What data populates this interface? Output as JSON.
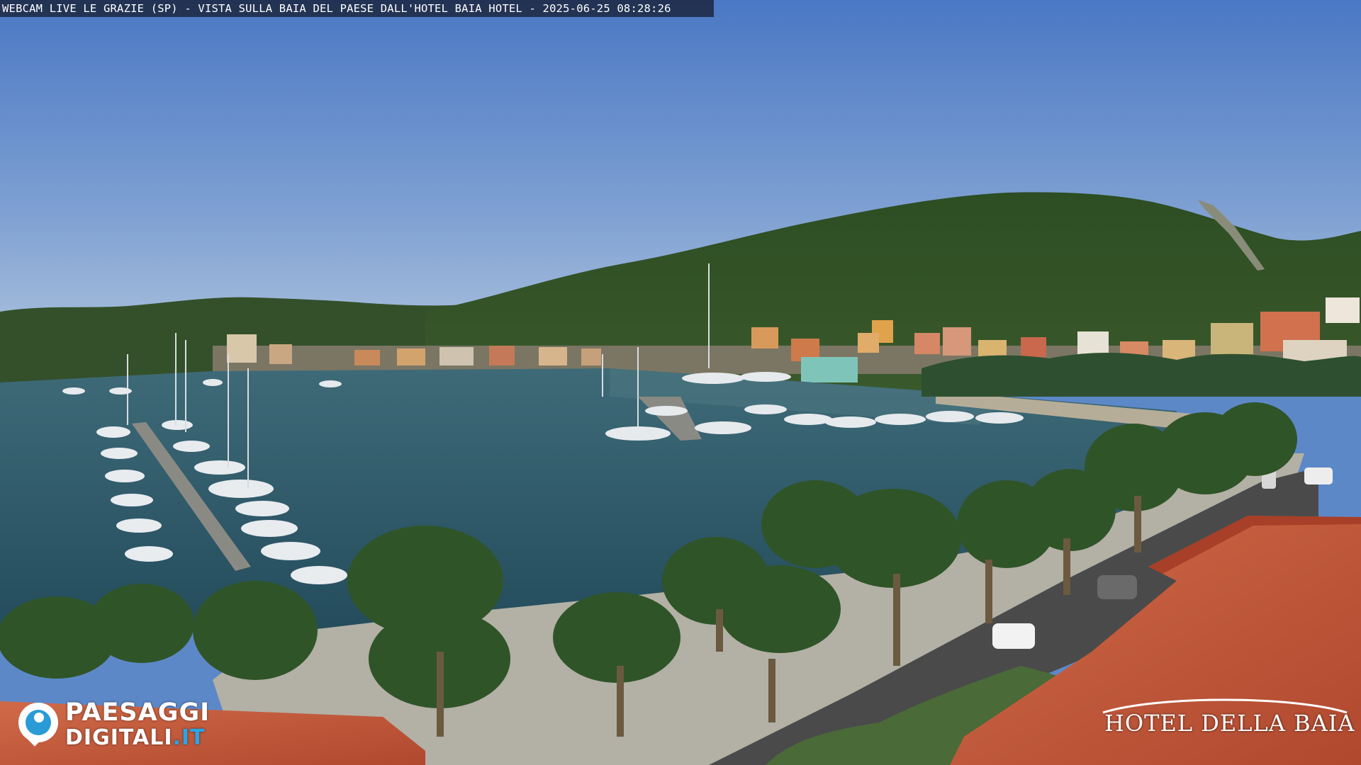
{
  "overlay": {
    "caption": "WEBCAM LIVE LE GRAZIE (SP) - VISTA SULLA BAIA DEL PAESE DALL'HOTEL BAIA HOTEL - 2025-06-25 08:28:26"
  },
  "branding": {
    "logo_icon": "paesaggi-digitali-pin-icon",
    "name_top": "PAESAGGI",
    "name_bottom": "DIGITALI",
    "name_suffix": ".IT",
    "accent_color": "#2aa5e6"
  },
  "hotel": {
    "name": "HOTEL DELLA BAIA"
  },
  "colors": {
    "sky_top": "#4a78c4",
    "sky_bottom": "#a8c2df",
    "sea": "#2f5a6a",
    "hills": "#2c4a22",
    "roof": "#c7583a"
  }
}
